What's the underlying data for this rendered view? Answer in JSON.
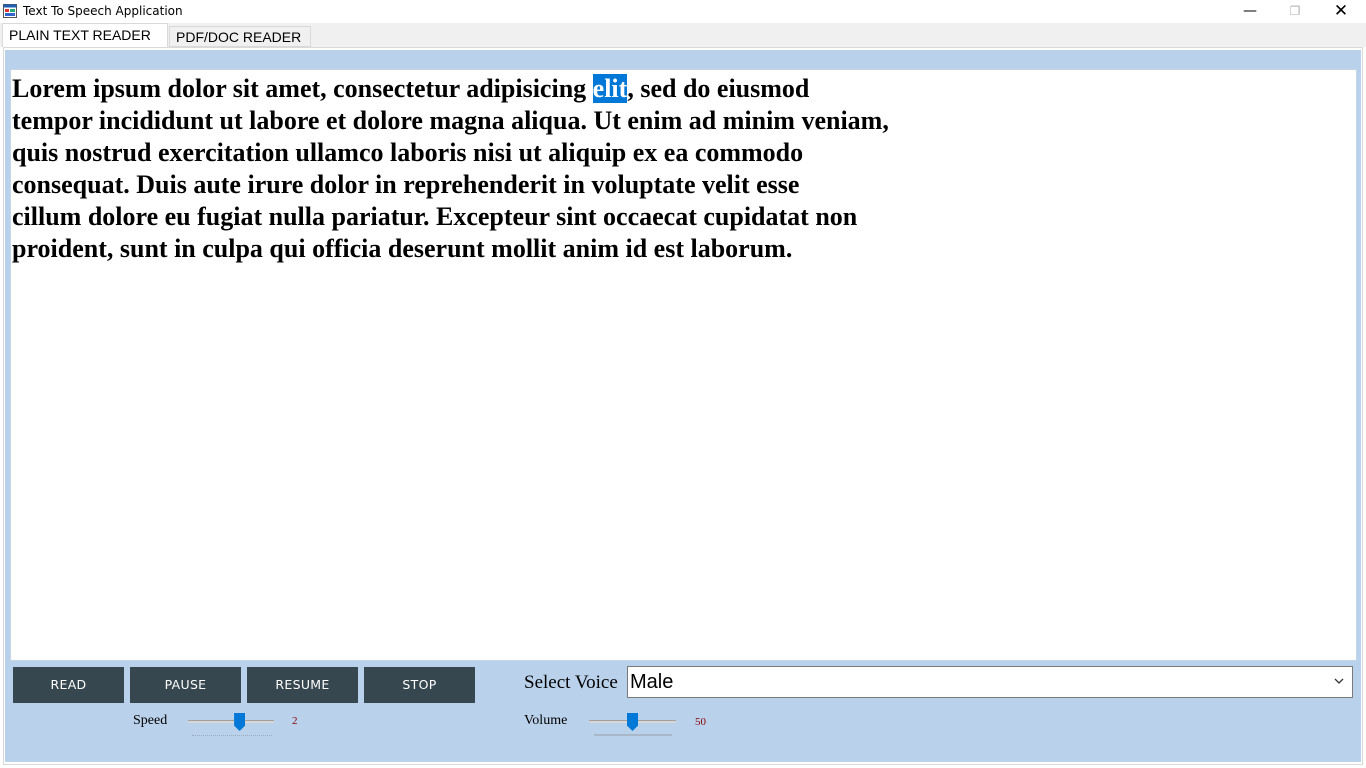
{
  "window": {
    "title": "Text To Speech Application",
    "icon": "app-window-icon",
    "controls": {
      "minimize": "—",
      "maximize": "❐",
      "close": "✕"
    }
  },
  "tabs": [
    {
      "label": "PLAIN TEXT READER",
      "active": true
    },
    {
      "label": "PDF/DOC READER",
      "active": false
    }
  ],
  "reader": {
    "text_before": "Lorem ipsum dolor sit amet, consectetur adipisicing ",
    "highlighted_word": "elit",
    "text_after": ", sed do eiusmod\ntempor incididunt ut labore et dolore magna aliqua. Ut enim ad minim veniam,\nquis nostrud exercitation ullamco laboris nisi ut aliquip ex ea commodo\nconsequat. Duis aute irure dolor in reprehenderit in voluptate velit esse\ncillum dolore eu fugiat nulla pariatur. Excepteur sint occaecat cupidatat non\nproident, sunt in culpa qui officia deserunt mollit anim id est laborum."
  },
  "controls": {
    "read_label": "READ",
    "pause_label": "PAUSE",
    "resume_label": "RESUME",
    "stop_label": "STOP"
  },
  "voice": {
    "label": "Select Voice",
    "selected": "Male"
  },
  "speed": {
    "label": "Speed",
    "value": "2",
    "level": 0.6
  },
  "volume": {
    "label": "Volume",
    "value": "50",
    "level": 0.5
  },
  "colors": {
    "panel": "#b9d1ea",
    "button": "#37474f",
    "highlight": "#0078d7",
    "slider_value": "#8b0000"
  }
}
